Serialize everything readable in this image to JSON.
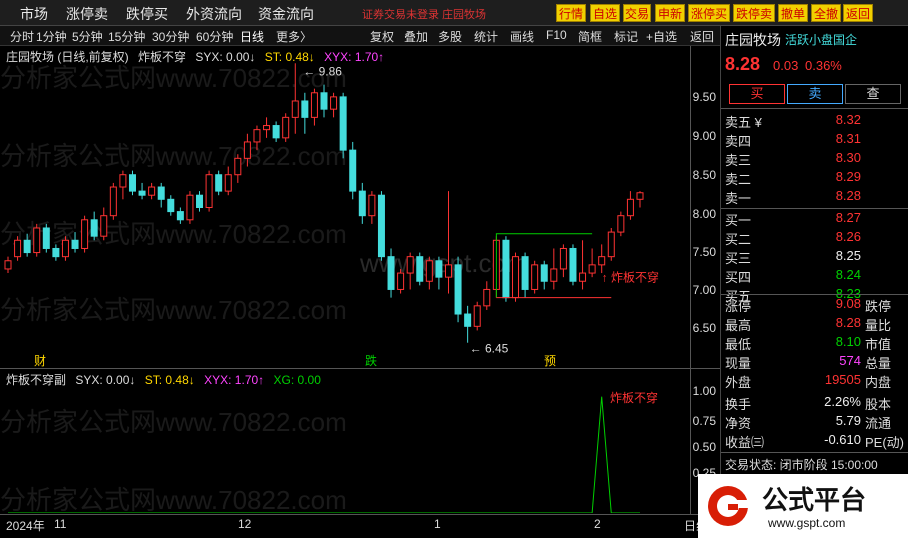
{
  "menu": [
    "市场",
    "涨停卖",
    "跌停买",
    "外资流向",
    "资金流向"
  ],
  "status_msg": "证券交易未登录 庄园牧场",
  "quick_buttons": [
    "行情",
    "自选",
    "交易",
    "申新",
    "涨停买",
    "跌停卖",
    "撤单",
    "全撤",
    "返回"
  ],
  "toolbar": {
    "periods": [
      "分时",
      "1分钟",
      "5分钟",
      "15分钟",
      "30分钟",
      "60分钟",
      "日线",
      "更多〉"
    ],
    "actions": [
      "复权",
      "叠加",
      "多股",
      "统计",
      "画线",
      "F10",
      "简框",
      "标记",
      "+自选",
      "返回"
    ]
  },
  "main_legend": {
    "title": "庄园牧场 (日线,前复权)",
    "indicator": "炸板不穿",
    "syx": "SYX: 0.00↓",
    "st": "ST: 0.48↓",
    "xyx": "XYX: 1.70↑"
  },
  "main_axis": [
    "9.50",
    "9.00",
    "8.50",
    "8.00",
    "7.50",
    "7.00",
    "6.50"
  ],
  "annotations": {
    "high": "9.86",
    "low": "6.45",
    "signal": "炸板不穿",
    "signal2": "炸板不穿"
  },
  "markers": {
    "cai": "财",
    "die": "跌",
    "yu": "预"
  },
  "sub_legend": {
    "name": "炸板不穿副",
    "syx": "SYX: 0.00↓",
    "st": "ST: 0.48↓",
    "xyx": "XYX: 1.70↑",
    "xg": "XG: 0.00"
  },
  "sub_axis": [
    "1.00",
    "0.75",
    "0.50",
    "0.25"
  ],
  "date_axis": {
    "year": "2024年",
    "m11": "11",
    "m12": "12",
    "m1": "1",
    "m2": "2",
    "right": "日线"
  },
  "watermark": "分析家公式网www.70822.com",
  "watermark2": "www.gspt.com",
  "stock": {
    "name": "庄园牧场",
    "tag": "活跃小盘国企",
    "price": "8.28",
    "change": "0.03",
    "pct": "0.36%"
  },
  "trade_buttons": {
    "buy": "买",
    "sell": "卖",
    "query": "查"
  },
  "asks": [
    {
      "label": "卖五 ¥",
      "price": "8.32"
    },
    {
      "label": "卖四",
      "price": "8.31"
    },
    {
      "label": "卖三",
      "price": "8.30"
    },
    {
      "label": "卖二",
      "price": "8.29"
    },
    {
      "label": "卖一",
      "price": "8.28"
    }
  ],
  "bids": [
    {
      "label": "买一",
      "price": "8.27"
    },
    {
      "label": "买二",
      "price": "8.26"
    },
    {
      "label": "买三",
      "price": "8.25"
    },
    {
      "label": "买四",
      "price": "8.24"
    },
    {
      "label": "买五",
      "price": "8.23"
    }
  ],
  "stats": [
    {
      "l": "涨停",
      "v": "9.08",
      "l2": "跌停",
      "c": "red"
    },
    {
      "l": "最高",
      "v": "8.28",
      "l2": "量比",
      "c": "red"
    },
    {
      "l": "最低",
      "v": "8.10",
      "l2": "市值",
      "c": "green"
    },
    {
      "l": "现量",
      "v": "574",
      "l2": "总量",
      "c": "pink"
    },
    {
      "l": "外盘",
      "v": "19505",
      "l2": "内盘",
      "c": "red"
    },
    {
      "l": "换手",
      "v": "2.26%",
      "l2": "股本",
      "c": "white"
    },
    {
      "l": "净资",
      "v": "5.79",
      "l2": "流通",
      "c": "white"
    },
    {
      "l": "收益㈢",
      "v": "-0.610",
      "l2": "PE(动)",
      "c": "white"
    }
  ],
  "trade_status": "交易状态: 闭市阶段 15:00:00",
  "logo": {
    "text": "公式平台",
    "url": "www.gspt.com"
  },
  "chart_data": {
    "type": "candlestick",
    "ylim": [
      6.3,
      9.9
    ],
    "candles": [
      [
        7.35,
        7.45,
        7.3,
        7.5
      ],
      [
        7.5,
        7.7,
        7.45,
        7.75
      ],
      [
        7.7,
        7.55,
        7.5,
        7.78
      ],
      [
        7.55,
        7.85,
        7.5,
        7.9
      ],
      [
        7.85,
        7.6,
        7.55,
        7.9
      ],
      [
        7.6,
        7.5,
        7.45,
        7.65
      ],
      [
        7.5,
        7.7,
        7.45,
        7.75
      ],
      [
        7.7,
        7.6,
        7.55,
        7.8
      ],
      [
        7.6,
        7.95,
        7.55,
        8.0
      ],
      [
        7.95,
        7.75,
        7.7,
        8.05
      ],
      [
        7.75,
        8.0,
        7.7,
        8.1
      ],
      [
        8.0,
        8.35,
        7.95,
        8.4
      ],
      [
        8.35,
        8.5,
        8.2,
        8.55
      ],
      [
        8.5,
        8.3,
        8.25,
        8.55
      ],
      [
        8.3,
        8.25,
        8.2,
        8.4
      ],
      [
        8.25,
        8.35,
        8.2,
        8.4
      ],
      [
        8.35,
        8.2,
        8.1,
        8.4
      ],
      [
        8.2,
        8.05,
        8.0,
        8.25
      ],
      [
        8.05,
        7.95,
        7.9,
        8.1
      ],
      [
        7.95,
        8.25,
        7.9,
        8.3
      ],
      [
        8.25,
        8.1,
        8.05,
        8.3
      ],
      [
        8.1,
        8.5,
        8.05,
        8.55
      ],
      [
        8.5,
        8.3,
        8.25,
        8.55
      ],
      [
        8.3,
        8.5,
        8.25,
        8.6
      ],
      [
        8.5,
        8.7,
        8.4,
        8.75
      ],
      [
        8.7,
        8.9,
        8.6,
        9.0
      ],
      [
        8.9,
        9.05,
        8.8,
        9.1
      ],
      [
        9.05,
        9.1,
        8.95,
        9.2
      ],
      [
        9.1,
        8.95,
        8.9,
        9.15
      ],
      [
        8.95,
        9.2,
        8.9,
        9.25
      ],
      [
        9.2,
        9.4,
        9.0,
        9.86
      ],
      [
        9.4,
        9.2,
        9.0,
        9.5
      ],
      [
        9.2,
        9.5,
        9.1,
        9.55
      ],
      [
        9.5,
        9.3,
        9.2,
        9.6
      ],
      [
        9.3,
        9.45,
        9.2,
        9.5
      ],
      [
        9.45,
        8.8,
        8.7,
        9.5
      ],
      [
        8.8,
        8.3,
        8.2,
        8.9
      ],
      [
        8.3,
        8.0,
        7.9,
        8.4
      ],
      [
        8.0,
        8.25,
        7.9,
        8.3
      ],
      [
        8.25,
        7.5,
        7.45,
        8.3
      ],
      [
        7.5,
        7.1,
        7.0,
        7.6
      ],
      [
        7.1,
        7.3,
        7.05,
        7.35
      ],
      [
        7.3,
        7.5,
        7.1,
        7.55
      ],
      [
        7.5,
        7.2,
        7.15,
        7.55
      ],
      [
        7.2,
        7.45,
        7.1,
        7.5
      ],
      [
        7.45,
        7.25,
        7.1,
        7.5
      ],
      [
        7.25,
        7.4,
        7.05,
        8.3
      ],
      [
        7.4,
        6.8,
        6.7,
        7.5
      ],
      [
        6.8,
        6.65,
        6.45,
        6.9
      ],
      [
        6.65,
        6.9,
        6.6,
        6.95
      ],
      [
        6.9,
        7.1,
        6.85,
        7.2
      ],
      [
        7.1,
        7.7,
        7.0,
        7.75
      ],
      [
        7.7,
        7.0,
        6.95,
        7.75
      ],
      [
        7.0,
        7.5,
        6.95,
        7.55
      ],
      [
        7.5,
        7.1,
        7.0,
        7.55
      ],
      [
        7.1,
        7.4,
        7.05,
        7.45
      ],
      [
        7.4,
        7.2,
        7.1,
        7.45
      ],
      [
        7.2,
        7.35,
        7.1,
        7.6
      ],
      [
        7.35,
        7.6,
        7.25,
        7.65
      ],
      [
        7.6,
        7.2,
        7.15,
        7.65
      ],
      [
        7.2,
        7.3,
        7.1,
        7.7
      ],
      [
        7.3,
        7.4,
        7.25,
        7.6
      ],
      [
        7.4,
        7.5,
        7.3,
        7.65
      ],
      [
        7.5,
        7.8,
        7.45,
        7.85
      ],
      [
        7.8,
        8.0,
        7.75,
        8.05
      ],
      [
        8.0,
        8.2,
        7.95,
        8.3
      ],
      [
        8.2,
        8.28,
        8.1,
        8.3
      ]
    ],
    "up_color": "#ff3333",
    "down_color": "#44dddd",
    "sub_ylim": [
      0,
      1.1
    ],
    "signal_index": [
      62
    ]
  }
}
